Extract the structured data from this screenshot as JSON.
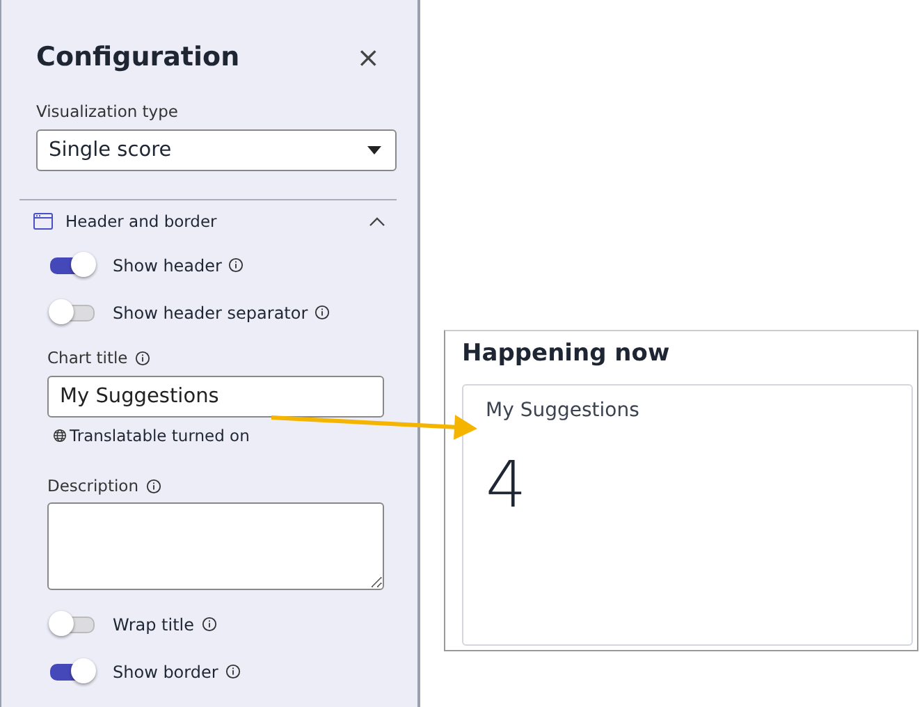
{
  "panel": {
    "title": "Configuration",
    "close": "×",
    "visualization": {
      "label": "Visualization type",
      "value": "Single score"
    },
    "section": {
      "title": "Header and border",
      "expanded": true
    },
    "toggles_top": [
      {
        "label": "Show header",
        "on": true
      },
      {
        "label": "Show header separator",
        "on": false
      }
    ],
    "chart_title": {
      "label": "Chart title",
      "value": "My Suggestions",
      "note": "Translatable turned on"
    },
    "description": {
      "label": "Description"
    },
    "toggles_bottom": [
      {
        "label": "Wrap title",
        "on": false
      },
      {
        "label": "Show border",
        "on": true
      }
    ]
  },
  "preview": {
    "title": "Happening now",
    "card": {
      "title": "My Suggestions",
      "score": "4"
    }
  }
}
